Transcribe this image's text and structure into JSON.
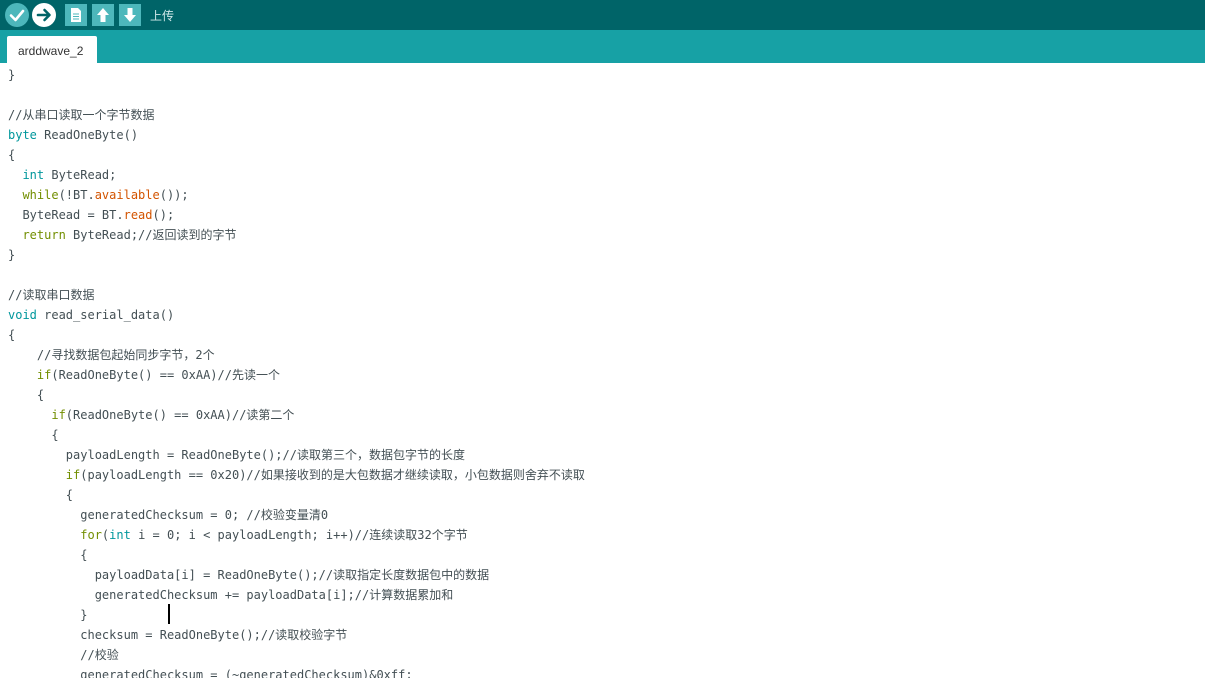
{
  "toolbar": {
    "verify_icon": "check-icon",
    "upload_icon": "arrow-right-icon",
    "new_icon": "new-file-icon",
    "open_icon": "arrow-up-icon",
    "save_icon": "arrow-down-icon",
    "hover_label": "上传"
  },
  "tabs": [
    {
      "label": "arddwave_2"
    }
  ],
  "code": [
    {
      "text": "}"
    },
    {
      "text": ""
    },
    {
      "text": "//从串口读取一个字节数据"
    },
    {
      "kw": "byte",
      "rest": " ReadOneByte()"
    },
    {
      "text": "{"
    },
    {
      "kw": "  int",
      "rest": " ByteRead;"
    },
    {
      "kw2": "  while",
      "a": "(!BT.",
      "fn": "available",
      "b": "());"
    },
    {
      "a": "  ByteRead = BT.",
      "fn": "read",
      "b": "();"
    },
    {
      "kw2": "  return",
      "rest": " ByteRead;//返回读到的字节"
    },
    {
      "text": "}"
    },
    {
      "text": ""
    },
    {
      "text": "//读取串口数据"
    },
    {
      "kw": "void",
      "rest": " read_serial_data()"
    },
    {
      "text": "{"
    },
    {
      "text": "    //寻找数据包起始同步字节，2个"
    },
    {
      "kw2": "    if",
      "rest": "(ReadOneByte() == 0xAA)//先读一个"
    },
    {
      "text": "    {"
    },
    {
      "kw2": "      if",
      "rest": "(ReadOneByte() == 0xAA)//读第二个"
    },
    {
      "text": "      {"
    },
    {
      "text": "        payloadLength = ReadOneByte();//读取第三个，数据包字节的长度"
    },
    {
      "kw2": "        if",
      "rest": "(payloadLength == 0x20)//如果接收到的是大包数据才继续读取，小包数据则舍弃不读取"
    },
    {
      "text": "        {"
    },
    {
      "text": "          generatedChecksum = 0; //校验变量清0"
    },
    {
      "kw2": "          for",
      "a": "(",
      "kw": "int",
      "b": " i = 0; i < payloadLength; i++)//连续读取32个字节"
    },
    {
      "text": "          {"
    },
    {
      "text": "            payloadData[i] = ReadOneByte();//读取指定长度数据包中的数据"
    },
    {
      "text": "            generatedChecksum += payloadData[i];//计算数据累加和"
    },
    {
      "text": "          }"
    },
    {
      "text": "          checksum = ReadOneByte();//读取校验字节"
    },
    {
      "text": "          //校验"
    },
    {
      "text": "          generatedChecksum = (~generatedChecksum)&0xff;"
    }
  ]
}
